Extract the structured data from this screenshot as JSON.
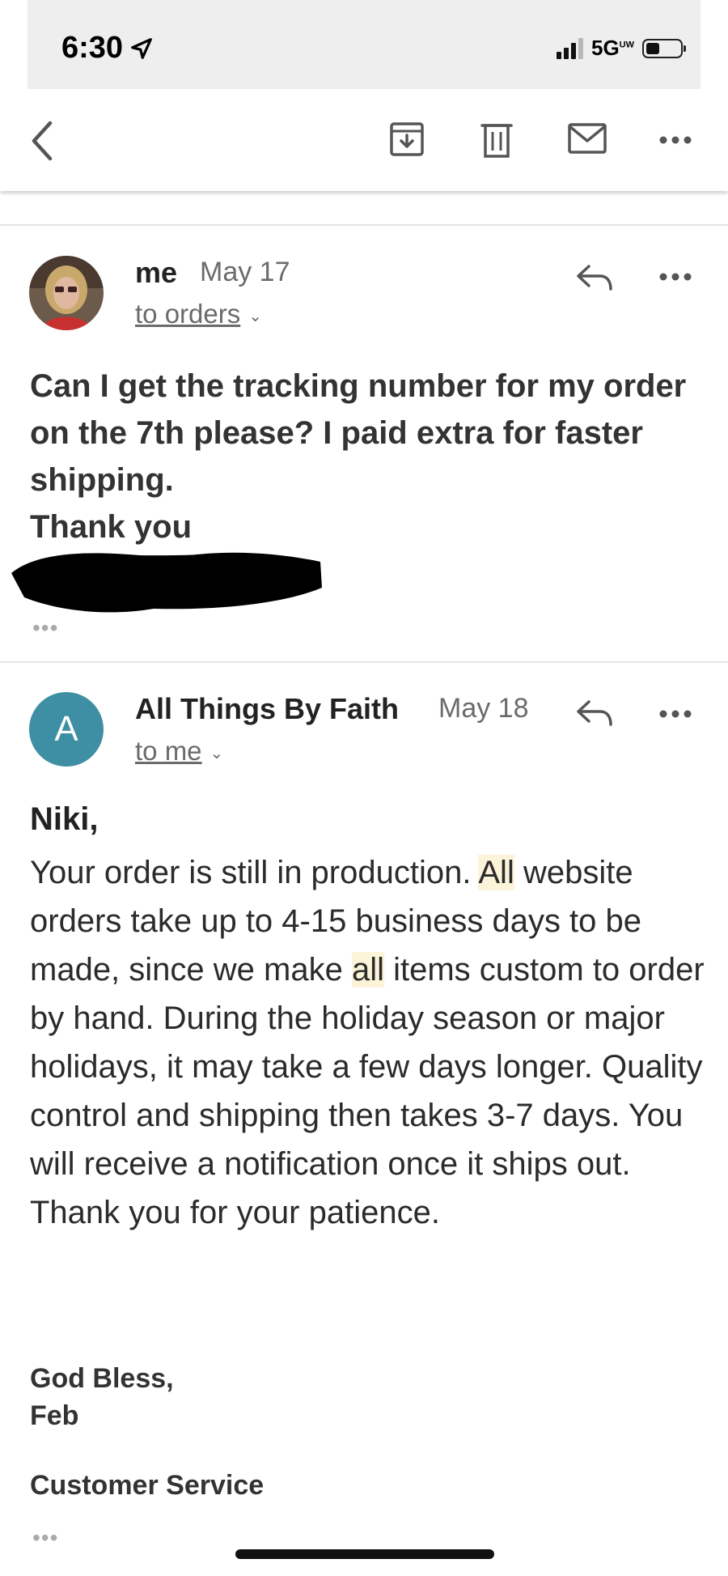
{
  "status_bar": {
    "time": "6:30",
    "network": "5G",
    "network_sup": "UW"
  },
  "toolbar": {
    "back_icon": "chevron-left-icon",
    "archive_icon": "archive-icon",
    "trash_icon": "trash-icon",
    "mail_icon": "mail-icon",
    "more_icon": "more-horizontal-icon"
  },
  "messages": [
    {
      "sender": "me",
      "date": "May 17",
      "recipient": "to orders",
      "body": "Can I get the tracking number for my order on the 7th please? I paid extra for faster shipping.",
      "closing": "Thank you",
      "ellipsis": "•••"
    },
    {
      "sender": "All Things By Faith",
      "avatar_letter": "A",
      "avatar_color": "#3e8fa3",
      "date": "May 18",
      "recipient": "to me",
      "greeting": "Niki,",
      "body_parts": [
        "Your order is still in production. ",
        "All",
        " website orders take up to 4-15 business days to be made, since we make ",
        "all",
        " items custom to order by hand. During the holiday season or major holidays, it may take a few days longer. Quality control and shipping then takes 3-7 days. You will receive a notification once it ships out. Thank you for your patience."
      ],
      "sign_off": "God Bless,",
      "signer": "Feb",
      "department": "Customer Service",
      "ellipsis": "•••"
    }
  ],
  "colors": {
    "highlight": "#fcf4d8",
    "muted": "#6b6b6b"
  }
}
